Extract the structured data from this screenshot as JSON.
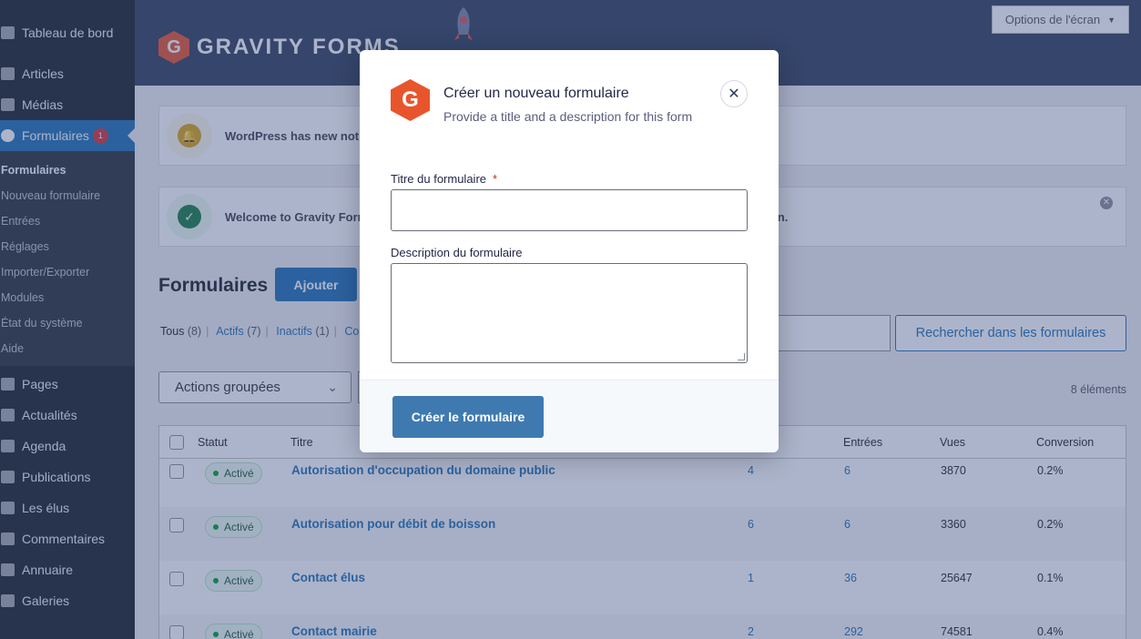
{
  "sidebar": {
    "items": [
      {
        "label": "Tableau de bord",
        "icon": "dashboard-icon"
      },
      {
        "label": "Articles",
        "icon": "pin-icon"
      },
      {
        "label": "Médias",
        "icon": "media-icon"
      },
      {
        "label": "Formulaires",
        "icon": "forms-icon",
        "badge": "1"
      },
      {
        "label": "Pages",
        "icon": "pages-icon"
      },
      {
        "label": "Actualités",
        "icon": "news-icon"
      },
      {
        "label": "Agenda",
        "icon": "calendar-icon"
      },
      {
        "label": "Publications",
        "icon": "publications-icon"
      },
      {
        "label": "Les élus",
        "icon": "award-icon"
      },
      {
        "label": "Commentaires",
        "icon": "comments-icon"
      },
      {
        "label": "Annuaire",
        "icon": "share-icon"
      },
      {
        "label": "Galeries",
        "icon": "gallery-icon"
      }
    ],
    "submenu": [
      "Formulaires",
      "Nouveau formulaire",
      "Entrées",
      "Réglages",
      "Importer/Exporter",
      "Modules",
      "État du système",
      "Aide"
    ]
  },
  "header": {
    "logo_letter": "G",
    "logo_text": "GRAVITY FORMS",
    "screen_options": "Options de l'écran"
  },
  "notices": {
    "update": "WordPress has new noti",
    "welcome_prefix": "Welcome to Gravity Form",
    "welcome_suffix": "sion."
  },
  "page": {
    "title": "Formulaires",
    "add_button": "Ajouter",
    "filters": {
      "all": "Tous",
      "all_count": "(8)",
      "active": "Actifs",
      "active_count": "(7)",
      "inactive": "Inactifs",
      "inactive_count": "(1)",
      "more": "Co"
    },
    "search_button": "Rechercher dans les formulaires",
    "bulk_actions": "Actions groupées",
    "item_count": "8 éléments"
  },
  "table": {
    "columns": {
      "status": "Statut",
      "title": "Titre",
      "entries": "Entrées",
      "views": "Vues",
      "conversion": "Conversion"
    },
    "rows": [
      {
        "status": "Activé",
        "title": "Autorisation d'occupation du domaine public",
        "id": "4",
        "entries": "6",
        "views": "3870",
        "conversion": "0.2%"
      },
      {
        "status": "Activé",
        "title": "Autorisation pour débit de boisson",
        "id": "6",
        "entries": "6",
        "views": "3360",
        "conversion": "0.2%"
      },
      {
        "status": "Activé",
        "title": "Contact élus",
        "id": "1",
        "entries": "36",
        "views": "25647",
        "conversion": "0.1%"
      },
      {
        "status": "Activé",
        "title": "Contact mairie",
        "id": "2",
        "entries": "292",
        "views": "74581",
        "conversion": "0.4%"
      }
    ]
  },
  "modal": {
    "logo_letter": "G",
    "title": "Créer un nouveau formulaire",
    "subtitle": "Provide a title and a description for this form",
    "close_symbol": "✕",
    "title_label": "Titre du formulaire",
    "required_mark": "*",
    "title_value": "",
    "description_label": "Description du formulaire",
    "description_value": "",
    "create_button": "Créer le formulaire"
  },
  "colors": {
    "brand_orange": "#e8552d",
    "wp_blue": "#2271b1",
    "sidebar_bg": "#1d2327",
    "header_bg": "#33415a",
    "primary_button": "#3e7ab0",
    "required_red": "#c02b0a"
  }
}
